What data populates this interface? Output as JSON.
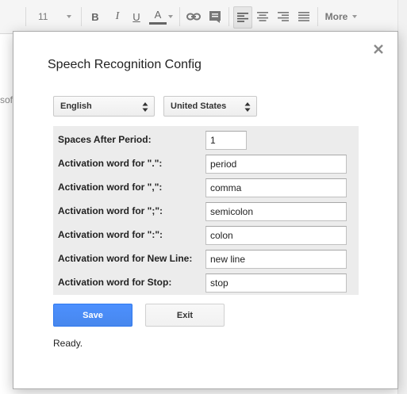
{
  "toolbar": {
    "font_size": "11",
    "bold_label": "B",
    "italic_label": "I",
    "underline_label": "U",
    "text_color_label": "A",
    "more_label": "More",
    "icons": [
      "chevron-down-icon",
      "link-icon",
      "comment-icon",
      "align-left-icon",
      "align-center-icon",
      "align-right-icon",
      "align-justify-icon"
    ]
  },
  "document": {
    "visible_fragment": "sof"
  },
  "dialog": {
    "title": "Speech Recognition Config",
    "close_icon": "close-icon",
    "language": {
      "selected": "English",
      "icon": "select-arrows-icon"
    },
    "region": {
      "selected": "United States",
      "icon": "select-arrows-icon"
    },
    "settings": [
      {
        "label": "Spaces After Period:",
        "value": "1"
      },
      {
        "label": "Activation word for \".\":",
        "value": "period"
      },
      {
        "label": "Activation word for \",\":",
        "value": "comma"
      },
      {
        "label": "Activation word for \";\":",
        "value": "semicolon"
      },
      {
        "label": "Activation word for \":\":",
        "value": "colon"
      },
      {
        "label": "Activation word for New Line:",
        "value": "new line"
      },
      {
        "label": "Activation word for Stop:",
        "value": "stop"
      }
    ],
    "save_label": "Save",
    "exit_label": "Exit",
    "status": "Ready."
  },
  "colors": {
    "primary_button": "#4d90fe",
    "panel_background": "#ececec",
    "toolbar_background": "#f5f5f5"
  }
}
